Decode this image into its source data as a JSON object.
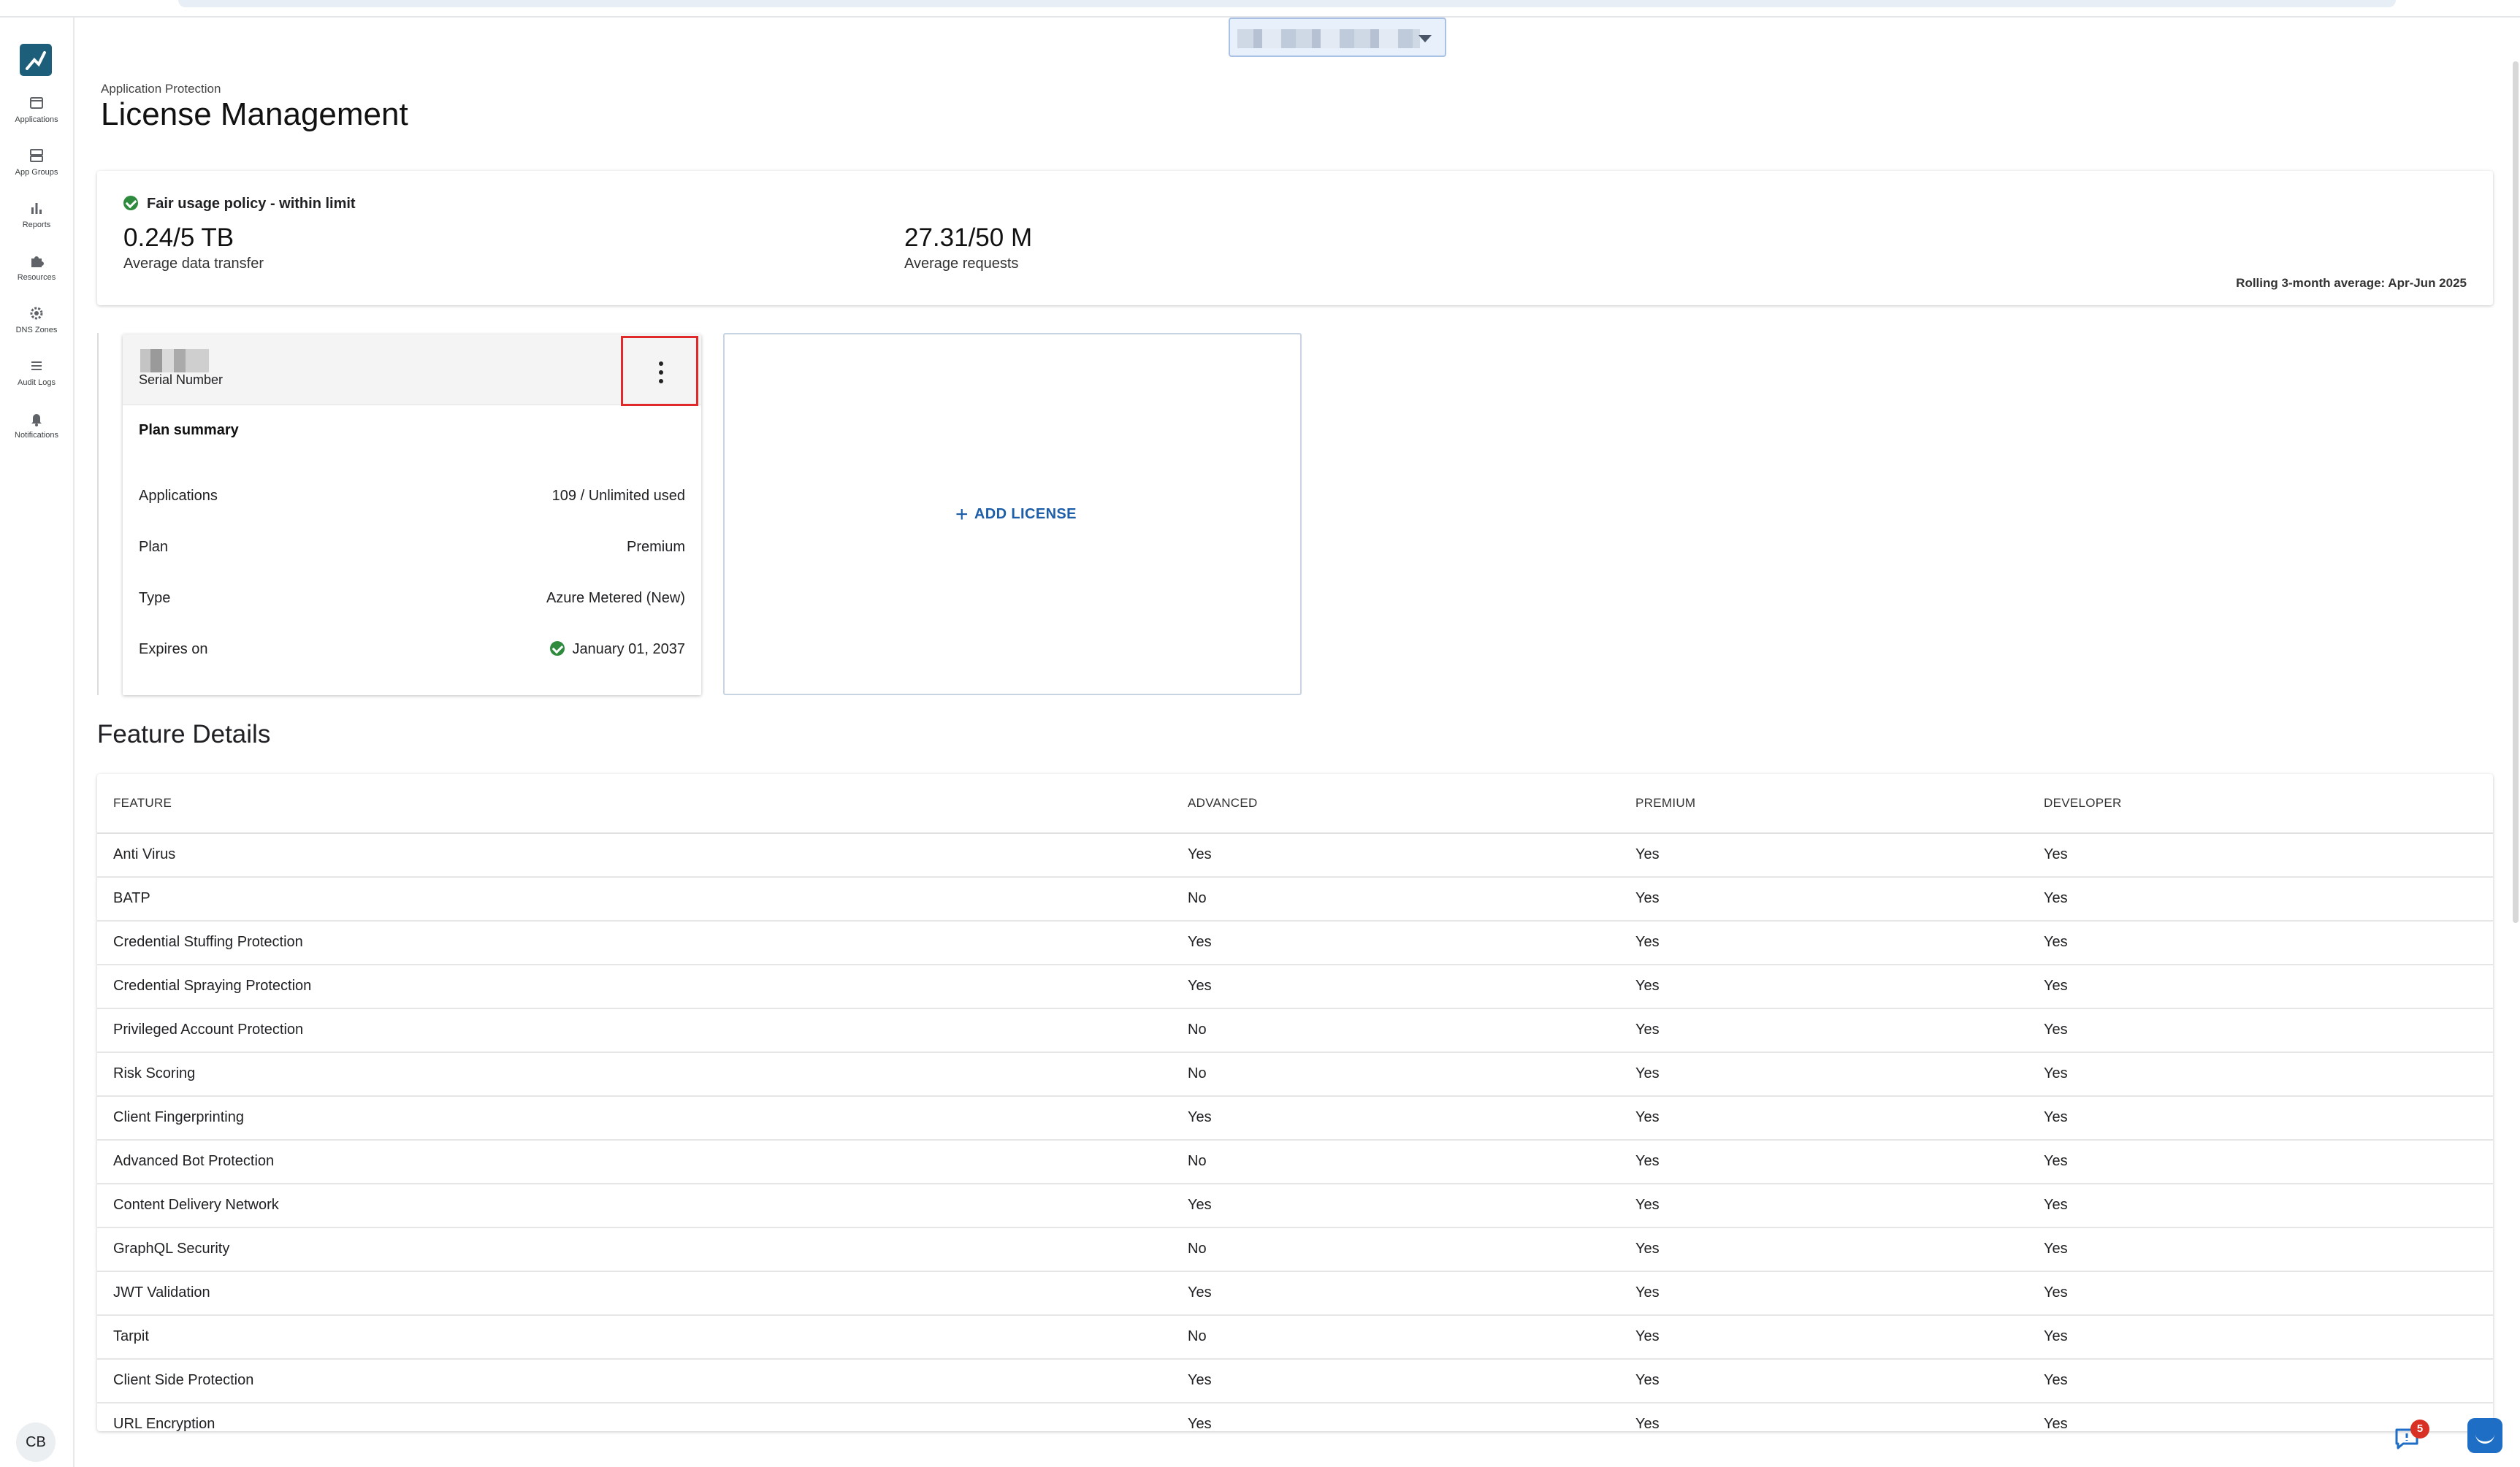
{
  "topbar": {
    "tenant_selector_value": ""
  },
  "sidebar": {
    "items": [
      {
        "label": "Applications",
        "icon": "applications-icon"
      },
      {
        "label": "App Groups",
        "icon": "app-groups-icon"
      },
      {
        "label": "Reports",
        "icon": "reports-icon"
      },
      {
        "label": "Resources",
        "icon": "resources-icon"
      },
      {
        "label": "DNS Zones",
        "icon": "dns-zones-icon"
      },
      {
        "label": "Audit Logs",
        "icon": "audit-logs-icon"
      },
      {
        "label": "Notifications",
        "icon": "notifications-icon"
      }
    ],
    "avatar_initials": "CB"
  },
  "header": {
    "breadcrumb": "Application Protection",
    "title": "License Management"
  },
  "usage": {
    "status": "Fair usage policy - within limit",
    "status_color": "#2e8b3e",
    "data_transfer_value": "0.24/5 TB",
    "data_transfer_label": "Average data transfer",
    "requests_value": "27.31/50 M",
    "requests_label": "Average requests",
    "rolling_note": "Rolling 3-month average: Apr-Jun 2025"
  },
  "license_card": {
    "serial_label": "Serial Number",
    "plan_summary_title": "Plan summary",
    "rows": [
      {
        "key": "Applications",
        "value": "109 / Unlimited used"
      },
      {
        "key": "Plan",
        "value": "Premium"
      },
      {
        "key": "Type",
        "value": "Azure Metered (New)"
      },
      {
        "key": "Expires on",
        "value": "January 01, 2037"
      }
    ]
  },
  "add_license": {
    "label": "ADD LICENSE"
  },
  "features": {
    "title": "Feature Details",
    "columns": [
      "FEATURE",
      "ADVANCED",
      "PREMIUM",
      "DEVELOPER"
    ],
    "rows": [
      [
        "Anti Virus",
        "Yes",
        "Yes",
        "Yes"
      ],
      [
        "BATP",
        "No",
        "Yes",
        "Yes"
      ],
      [
        "Credential Stuffing Protection",
        "Yes",
        "Yes",
        "Yes"
      ],
      [
        "Credential Spraying Protection",
        "Yes",
        "Yes",
        "Yes"
      ],
      [
        "Privileged Account Protection",
        "No",
        "Yes",
        "Yes"
      ],
      [
        "Risk Scoring",
        "No",
        "Yes",
        "Yes"
      ],
      [
        "Client Fingerprinting",
        "Yes",
        "Yes",
        "Yes"
      ],
      [
        "Advanced Bot Protection",
        "No",
        "Yes",
        "Yes"
      ],
      [
        "Content Delivery Network",
        "Yes",
        "Yes",
        "Yes"
      ],
      [
        "GraphQL Security",
        "No",
        "Yes",
        "Yes"
      ],
      [
        "JWT Validation",
        "Yes",
        "Yes",
        "Yes"
      ],
      [
        "Tarpit",
        "No",
        "Yes",
        "Yes"
      ],
      [
        "Client Side Protection",
        "Yes",
        "Yes",
        "Yes"
      ],
      [
        "URL Encryption",
        "Yes",
        "Yes",
        "Yes"
      ]
    ]
  },
  "footer": {
    "notifications_badge": "5"
  },
  "colors": {
    "accent": "#1d5ea8",
    "highlight_border": "#e0292b",
    "logo_bg": "#1d5f7a"
  }
}
